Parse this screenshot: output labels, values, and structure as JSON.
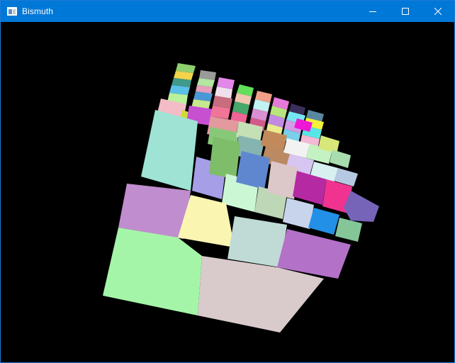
{
  "window": {
    "title": "Bismuth",
    "controls": {
      "minimize": "minimize-icon",
      "maximize": "maximize-icon",
      "close": "close-icon"
    },
    "titlebar_color": "#0078d7",
    "background_color": "#000000"
  }
}
